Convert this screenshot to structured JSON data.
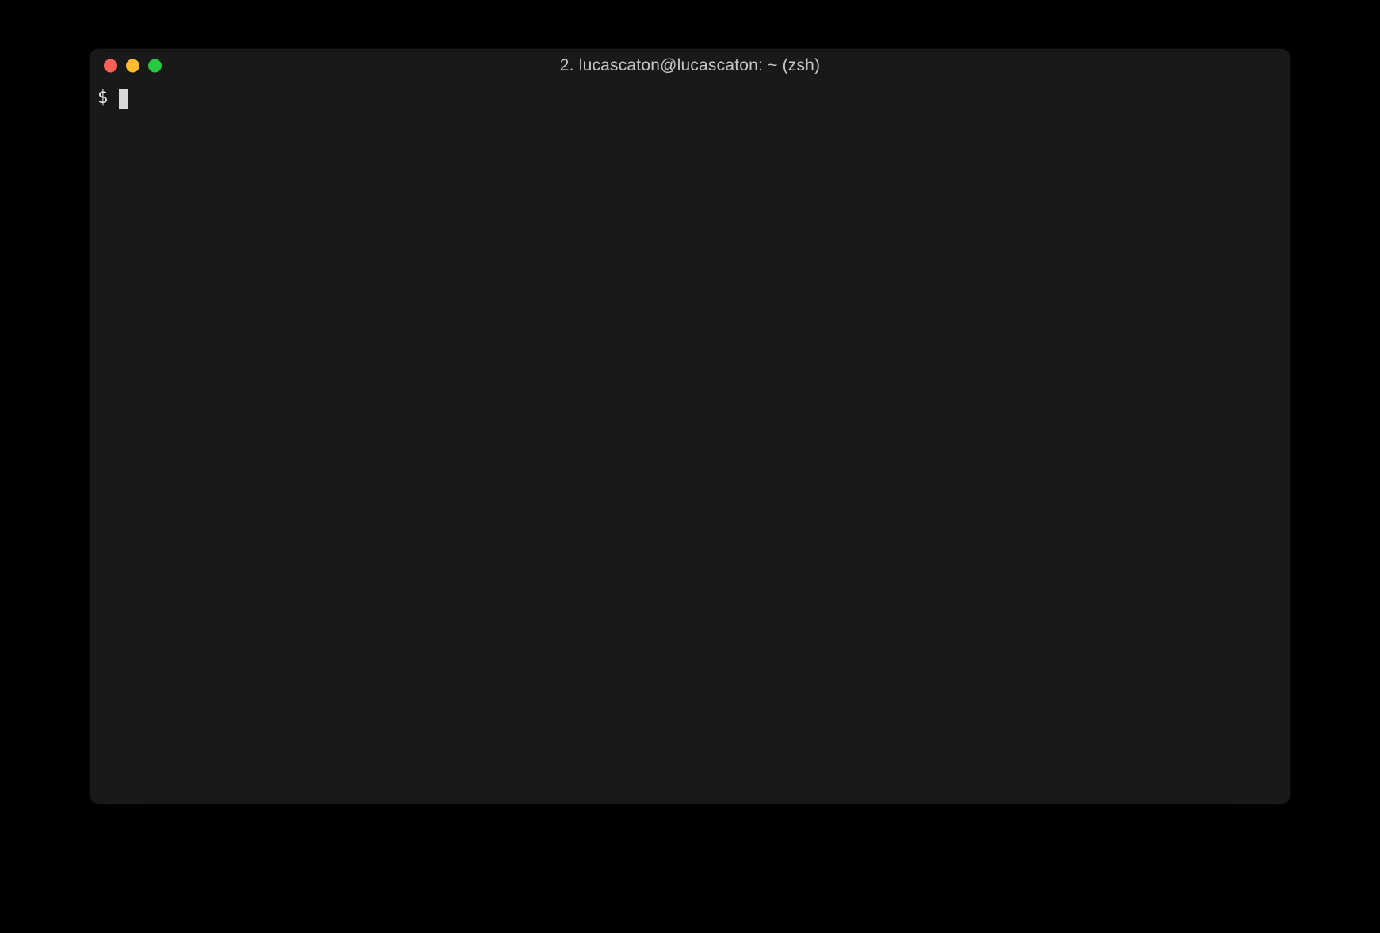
{
  "window": {
    "title": "2. lucascaton@lucascaton: ~ (zsh)"
  },
  "terminal": {
    "prompt": "$"
  }
}
